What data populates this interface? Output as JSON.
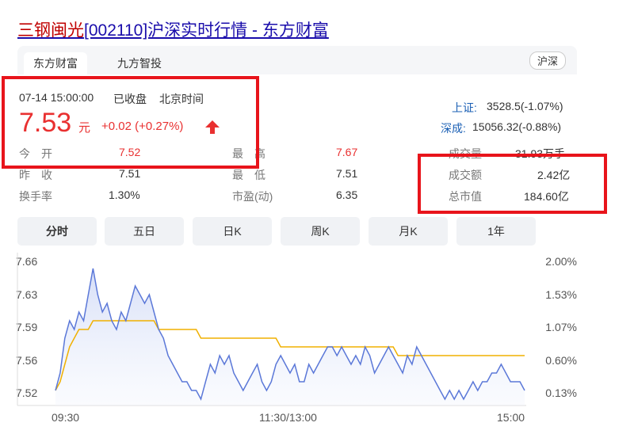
{
  "header": {
    "stock_name": "三钢闽光",
    "title_rest": "[002110]沪深实时行情 - 东方财富"
  },
  "tabs": [
    {
      "label": "东方财富",
      "active": true
    },
    {
      "label": "九方智投",
      "active": false
    }
  ],
  "market_badge": "沪深",
  "quote": {
    "datetime": "07-14 15:00:00",
    "status": "已收盘",
    "timezone": "北京时间",
    "price": "7.53",
    "unit": "元",
    "change": "+0.02 (+0.27%)"
  },
  "stats": {
    "open_label": "今　开",
    "open": "7.52",
    "high_label": "最　高",
    "high": "7.67",
    "prev_close_label": "昨　收",
    "prev_close": "7.51",
    "low_label": "最　低",
    "low": "7.51",
    "turnover_rate_label": "换手率",
    "turnover_rate": "1.30%",
    "pe_label": "市盈(动)",
    "pe": "6.35",
    "volume_label": "成交量",
    "volume": "31.93万手",
    "amount_label": "成交额",
    "amount": "2.42亿",
    "market_cap_label": "总市值",
    "market_cap": "184.60亿"
  },
  "indices": [
    {
      "name": "上证:",
      "value": "3528.5(-1.07%)"
    },
    {
      "name": "深成:",
      "value": "15056.32(-0.88%)"
    }
  ],
  "periods": [
    "分时",
    "五日",
    "日K",
    "周K",
    "月K",
    "1年"
  ],
  "colors": {
    "up": "#e93030",
    "price_line": "#5b78d8",
    "avg_line": "#f0b000",
    "highlight_box": "#e8141b"
  },
  "chart_data": {
    "type": "line",
    "title": "",
    "x_ticks": [
      "09:30",
      "11:30/13:00",
      "15:00"
    ],
    "y_ticks_left": [
      "7.66",
      "7.63",
      "7.59",
      "7.56",
      "7.52"
    ],
    "y_ticks_right": [
      "2.00%",
      "1.53%",
      "1.07%",
      "0.60%",
      "0.13%"
    ],
    "ylim": [
      7.51,
      7.67
    ],
    "series": [
      {
        "values": [
          7.52,
          7.54,
          7.58,
          7.6,
          7.59,
          7.61,
          7.6,
          7.63,
          7.66,
          7.63,
          7.61,
          7.62,
          7.6,
          7.59,
          7.61,
          7.6,
          7.62,
          7.64,
          7.63,
          7.62,
          7.63,
          7.61,
          7.59,
          7.58,
          7.56,
          7.55,
          7.54,
          7.53,
          7.53,
          7.52,
          7.52,
          7.51,
          7.53,
          7.55,
          7.54,
          7.56,
          7.55,
          7.56,
          7.54,
          7.53,
          7.52,
          7.53,
          7.54,
          7.55,
          7.53,
          7.52,
          7.53,
          7.55,
          7.56,
          7.55,
          7.54,
          7.55,
          7.53,
          7.53,
          7.55,
          7.54,
          7.55,
          7.56,
          7.57,
          7.57,
          7.56,
          7.57,
          7.56,
          7.55,
          7.56,
          7.55,
          7.57,
          7.56,
          7.54,
          7.55,
          7.56,
          7.57,
          7.56,
          7.55,
          7.54,
          7.56,
          7.55,
          7.57,
          7.56,
          7.55,
          7.54,
          7.53,
          7.52,
          7.51,
          7.52,
          7.51,
          7.52,
          7.51,
          7.52,
          7.53,
          7.52,
          7.53,
          7.53,
          7.54,
          7.54,
          7.55,
          7.54,
          7.53,
          7.53,
          7.53,
          7.52
        ]
      },
      {
        "values": [
          7.52,
          7.53,
          7.55,
          7.57,
          7.58,
          7.59,
          7.59,
          7.59,
          7.6,
          7.6,
          7.6,
          7.6,
          7.6,
          7.6,
          7.6,
          7.6,
          7.6,
          7.6,
          7.6,
          7.6,
          7.6,
          7.6,
          7.59,
          7.59,
          7.59,
          7.59,
          7.59,
          7.59,
          7.59,
          7.59,
          7.59,
          7.58,
          7.58,
          7.58,
          7.58,
          7.58,
          7.58,
          7.58,
          7.58,
          7.58,
          7.58,
          7.58,
          7.58,
          7.58,
          7.58,
          7.58,
          7.58,
          7.58,
          7.57,
          7.57,
          7.57,
          7.57,
          7.57,
          7.57,
          7.57,
          7.57,
          7.57,
          7.57,
          7.57,
          7.57,
          7.57,
          7.57,
          7.57,
          7.57,
          7.57,
          7.57,
          7.57,
          7.57,
          7.57,
          7.57,
          7.57,
          7.57,
          7.57,
          7.56,
          7.56,
          7.56,
          7.56,
          7.56,
          7.56,
          7.56,
          7.56,
          7.56,
          7.56,
          7.56,
          7.56,
          7.56,
          7.56,
          7.56,
          7.56,
          7.56,
          7.56,
          7.56,
          7.56,
          7.56,
          7.56,
          7.56,
          7.56,
          7.56,
          7.56,
          7.56,
          7.56
        ]
      }
    ]
  }
}
